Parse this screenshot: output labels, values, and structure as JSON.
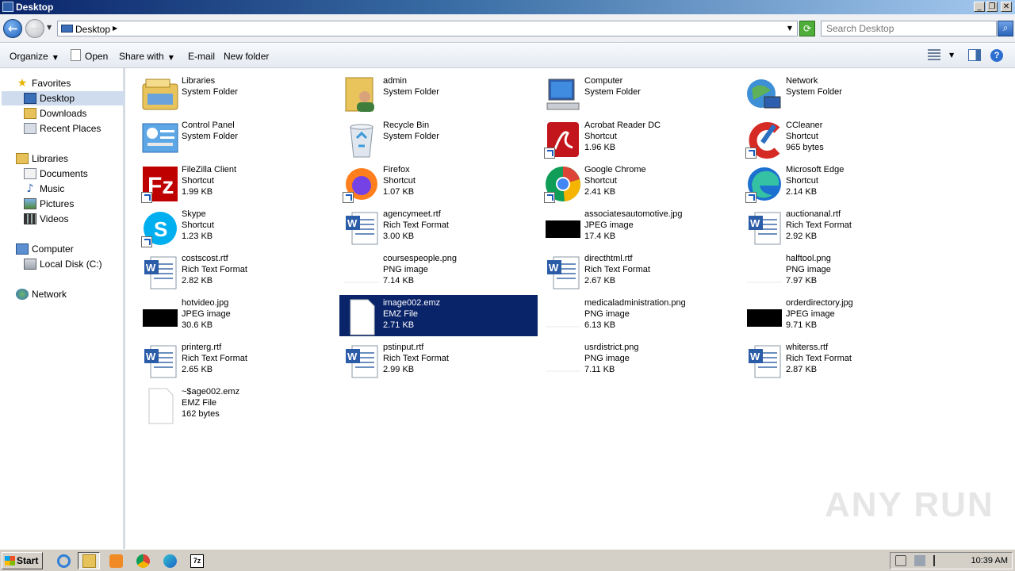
{
  "window": {
    "title": "Desktop"
  },
  "address": {
    "text": "Desktop"
  },
  "search": {
    "placeholder": "Search Desktop"
  },
  "toolbar": {
    "organize": "Organize",
    "open": "Open",
    "share_with": "Share with",
    "email": "E-mail",
    "new_folder": "New folder"
  },
  "nav": {
    "favorites": "Favorites",
    "desktop": "Desktop",
    "downloads": "Downloads",
    "recent_places": "Recent Places",
    "libraries": "Libraries",
    "documents": "Documents",
    "music": "Music",
    "pictures": "Pictures",
    "videos": "Videos",
    "computer": "Computer",
    "local_disk": "Local Disk (C:)",
    "network": "Network"
  },
  "items": [
    {
      "name": "Libraries",
      "type": "System Folder",
      "size": "",
      "icon": "libraries-icon"
    },
    {
      "name": "admin",
      "type": "System Folder",
      "size": "",
      "icon": "user-folder-icon"
    },
    {
      "name": "Computer",
      "type": "System Folder",
      "size": "",
      "icon": "computer-icon"
    },
    {
      "name": "Network",
      "type": "System Folder",
      "size": "",
      "icon": "network-icon"
    },
    {
      "name": "Control Panel",
      "type": "System Folder",
      "size": "",
      "icon": "control-panel-icon"
    },
    {
      "name": "Recycle Bin",
      "type": "System Folder",
      "size": "",
      "icon": "recycle-bin-icon"
    },
    {
      "name": "Acrobat Reader DC",
      "type": "Shortcut",
      "size": "1.96 KB",
      "icon": "acrobat-icon"
    },
    {
      "name": "CCleaner",
      "type": "Shortcut",
      "size": "965 bytes",
      "icon": "ccleaner-icon"
    },
    {
      "name": "FileZilla Client",
      "type": "Shortcut",
      "size": "1.99 KB",
      "icon": "filezilla-icon"
    },
    {
      "name": "Firefox",
      "type": "Shortcut",
      "size": "1.07 KB",
      "icon": "firefox-icon"
    },
    {
      "name": "Google Chrome",
      "type": "Shortcut",
      "size": "2.41 KB",
      "icon": "chrome-icon"
    },
    {
      "name": "Microsoft Edge",
      "type": "Shortcut",
      "size": "2.14 KB",
      "icon": "edge-icon"
    },
    {
      "name": "Skype",
      "type": "Shortcut",
      "size": "1.23 KB",
      "icon": "skype-icon"
    },
    {
      "name": "agencymeet.rtf",
      "type": "Rich Text Format",
      "size": "3.00 KB",
      "icon": "word-doc-icon"
    },
    {
      "name": "associatesautomotive.jpg",
      "type": "JPEG image",
      "size": "17.4 KB",
      "icon": "black-thumbnail-icon"
    },
    {
      "name": "auctionanal.rtf",
      "type": "Rich Text Format",
      "size": "2.92 KB",
      "icon": "word-doc-icon"
    },
    {
      "name": "costscost.rtf",
      "type": "Rich Text Format",
      "size": "2.82 KB",
      "icon": "word-doc-icon"
    },
    {
      "name": "coursespeople.png",
      "type": "PNG image",
      "size": "7.14 KB",
      "icon": "white-thumbnail-icon"
    },
    {
      "name": "directhtml.rtf",
      "type": "Rich Text Format",
      "size": "2.67 KB",
      "icon": "word-doc-icon"
    },
    {
      "name": "halftool.png",
      "type": "PNG image",
      "size": "7.97 KB",
      "icon": "white-thumbnail-icon"
    },
    {
      "name": "hotvideo.jpg",
      "type": "JPEG image",
      "size": "30.6 KB",
      "icon": "black-thumbnail-icon"
    },
    {
      "name": "image002.emz",
      "type": "EMZ File",
      "size": "2.71 KB",
      "icon": "blank-file-icon",
      "selected": true
    },
    {
      "name": "medicaladministration.png",
      "type": "PNG image",
      "size": "6.13 KB",
      "icon": "white-thumbnail-icon"
    },
    {
      "name": "orderdirectory.jpg",
      "type": "JPEG image",
      "size": "9.71 KB",
      "icon": "black-thumbnail-icon"
    },
    {
      "name": "printerg.rtf",
      "type": "Rich Text Format",
      "size": "2.65 KB",
      "icon": "word-doc-icon"
    },
    {
      "name": "pstinput.rtf",
      "type": "Rich Text Format",
      "size": "2.99 KB",
      "icon": "word-doc-icon"
    },
    {
      "name": "usrdistrict.png",
      "type": "PNG image",
      "size": "7.11 KB",
      "icon": "white-thumbnail-icon"
    },
    {
      "name": "whiterss.rtf",
      "type": "Rich Text Format",
      "size": "2.87 KB",
      "icon": "word-doc-icon"
    },
    {
      "name": "~$age002.emz",
      "type": "EMZ File",
      "size": "162 bytes",
      "icon": "blank-file-icon"
    }
  ],
  "taskbar": {
    "start": "Start",
    "clock": "10:39 AM"
  },
  "watermark": "ANY RUN",
  "colors": {
    "selection": "#0a246a",
    "title_bar": "#0a246a",
    "nav_selected": "#cfdcee"
  }
}
